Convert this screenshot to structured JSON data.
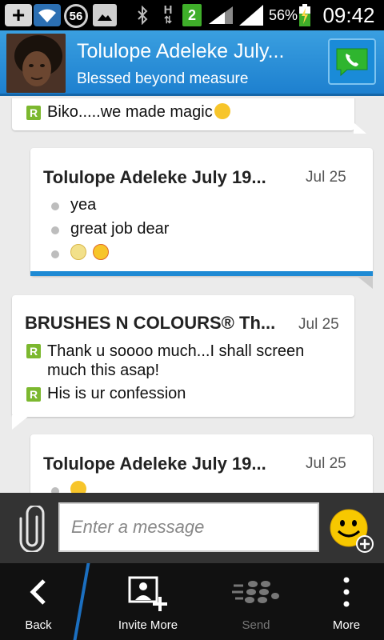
{
  "status_bar": {
    "notification_count": "56",
    "network_type": "H",
    "sim_slot": "2",
    "battery_percent": "56%",
    "time": "09:42"
  },
  "header": {
    "contact_name": "Tolulope Adeleke July...",
    "status_message": "Blessed beyond measure"
  },
  "messages": [
    {
      "sender": "",
      "date": "",
      "items": [
        {
          "text": "Biko.....we made magic",
          "emoji": "laughing"
        }
      ]
    },
    {
      "sender": "Tolulope Adeleke July 19...",
      "date": "Jul 25",
      "items": [
        {
          "text": "yea"
        },
        {
          "text": "great job dear"
        },
        {
          "text": "",
          "emojis": [
            "grinning",
            "heart-eyes"
          ]
        }
      ]
    },
    {
      "sender": "BRUSHES N COLOURS® Th...",
      "date": "Jul 25",
      "items": [
        {
          "text": "Thank u soooo much...I shall screen much this asap!"
        },
        {
          "text": "His is ur confession"
        }
      ]
    },
    {
      "sender": "Tolulope Adeleke July 19...",
      "date": "Jul 25",
      "items": [
        {
          "text": "",
          "emoji": "laughing"
        }
      ]
    }
  ],
  "composer": {
    "placeholder": "Enter a message"
  },
  "bottom_nav": {
    "back": "Back",
    "invite_more": "Invite More",
    "send": "Send",
    "more": "More"
  },
  "colors": {
    "header_blue": "#1d80cf",
    "accent_green": "#7cb82f",
    "read_bar_blue": "#1e8ad4"
  }
}
